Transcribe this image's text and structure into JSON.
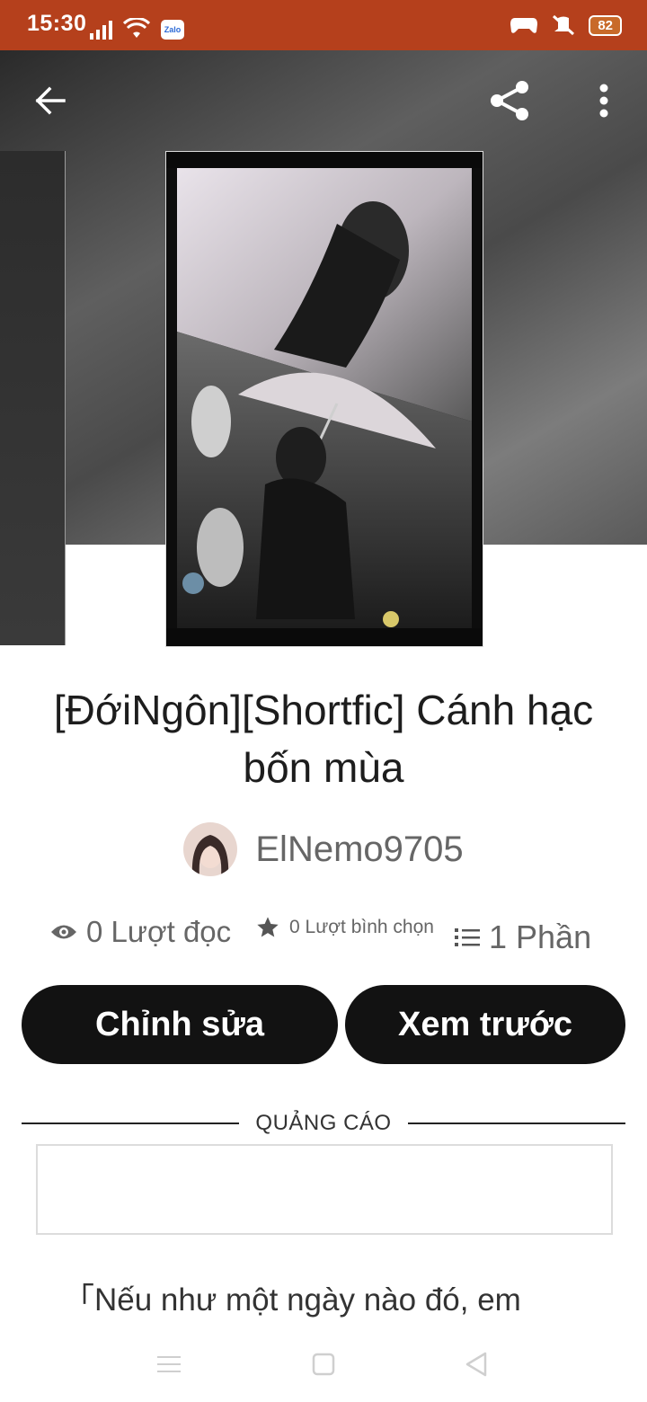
{
  "status": {
    "time": "15:30",
    "battery": "82",
    "icons": [
      "signal-icon",
      "wifi-icon",
      "zalo-icon",
      "game-icon",
      "mute-vibrate-icon",
      "battery-icon"
    ],
    "zalo_label": "Zalo"
  },
  "toolbar": {
    "back_icon": "back-arrow-icon",
    "share_icon": "share-icon",
    "more_icon": "more-vert-icon"
  },
  "story": {
    "title": "[ĐớiNgôn][Shortfic] Cánh hạc bốn mùa",
    "author": "ElNemo9705",
    "reads": "0 Lượt đọc",
    "votes": "0 Lượt bình chọn",
    "parts": "1 Phần"
  },
  "actions": {
    "edit_label": "Chỉnh sửa",
    "preview_label": "Xem trước"
  },
  "ad": {
    "label": "QUẢNG CÁO"
  },
  "excerpt": "「Nếu như một ngày nào đó, em",
  "colors": {
    "status_bar": "#b5401c",
    "button_bg": "#121212",
    "text_muted": "#666666"
  }
}
